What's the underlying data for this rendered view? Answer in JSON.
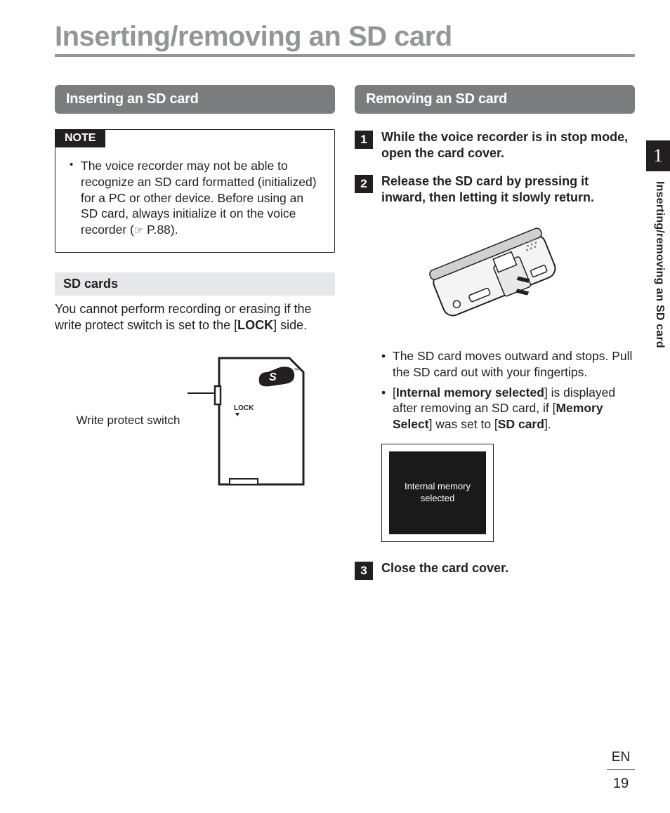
{
  "page_title": "Inserting/removing an SD card",
  "left": {
    "section_header": "Inserting an SD card",
    "note_label": "NOTE",
    "note_text_before": "The voice recorder may not be able to recognize an SD card formatted (initialized) for a PC or other device. Before using an SD card, always initialize it on the voice recorder (",
    "note_ref_icon": "☞",
    "note_text_after": " P.88).",
    "sub_header": "SD cards",
    "sd_text_1": "You cannot perform recording or erasing if the write protect switch is set to the [",
    "sd_lock": "LOCK",
    "sd_text_2": "] side.",
    "sd_caption": "Write protect switch",
    "sd_lock_label": "LOCK"
  },
  "right": {
    "section_header": "Removing an SD card",
    "steps": {
      "1": "While the voice recorder is in stop mode, open the card cover.",
      "2": "Release the SD card by pressing it inward, then letting it slowly return.",
      "3": "Close the card cover."
    },
    "bullet1": "The SD card moves outward and stops. Pull the SD card out with your fingertips.",
    "bullet2_a": "[",
    "bullet2_b": "Internal memory selected",
    "bullet2_c": "] is displayed after removing an SD card, if [",
    "bullet2_d": "Memory Select",
    "bullet2_e": "] was set to [",
    "bullet2_f": "SD card",
    "bullet2_g": "].",
    "screen_line1": "Internal memory",
    "screen_line2": "selected"
  },
  "side": {
    "chapter": "1",
    "label": "Inserting/removing an SD card"
  },
  "footer": {
    "lang": "EN",
    "page": "19"
  }
}
